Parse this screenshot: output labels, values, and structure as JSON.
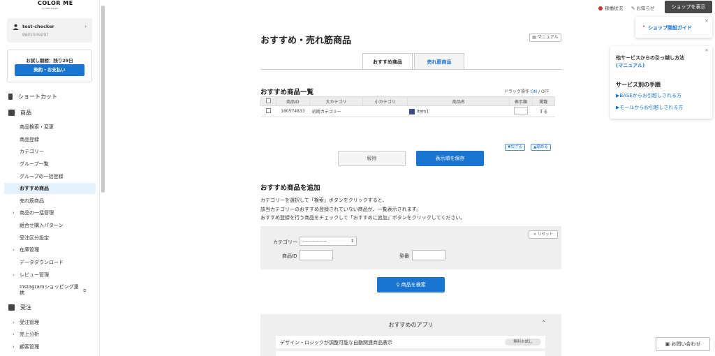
{
  "sidebar": {
    "logo": "COLOR ME",
    "logo_sub": "by GMO Pepabo",
    "account": {
      "name": "test-checker",
      "id": "PA01509297"
    },
    "trial": {
      "text": "お試し期間：残り29日",
      "button": "契約・お支払い"
    },
    "sections": {
      "shortcut": "ショートカット",
      "products": "商品",
      "orders": "受注"
    },
    "items": [
      {
        "label": "商品検索・変更"
      },
      {
        "label": "商品登録"
      },
      {
        "label": "カテゴリー"
      },
      {
        "label": "グループ一覧"
      },
      {
        "label": "グループの一括登録"
      },
      {
        "label": "おすすめ商品"
      },
      {
        "label": "売れ筋商品"
      },
      {
        "label": "商品の一括管理"
      },
      {
        "label": "組合せ購入パターン"
      },
      {
        "label": "受注区分設定"
      },
      {
        "label": "在庫管理"
      },
      {
        "label": "データダウンロード"
      },
      {
        "label": "レビュー管理"
      },
      {
        "label": "Instagramショッピング連携"
      }
    ],
    "order_items": [
      {
        "label": "受注管理"
      },
      {
        "label": "売上分析"
      },
      {
        "label": "顧客管理"
      }
    ]
  },
  "topbar": {
    "status": "稼働状況",
    "notice": "お知らせ",
    "shop_button": "ショップを表示"
  },
  "popups": {
    "guide": "ショップ開設ガイド",
    "move_line1": "他サービスからの引っ越し方法",
    "move_line2": "(マニュアル)",
    "move_heading": "サービス別の手順",
    "move_base": "▶BASEからお引越しされる方",
    "move_mall": "▶モールからお引越しされる方"
  },
  "main": {
    "title": "おすすめ・売れ筋商品",
    "manual": "マニュアル",
    "tabs": [
      "おすすめ商品",
      "売れ筋商品"
    ],
    "list_title": "おすすめ商品一覧",
    "drag_label": "ドラッグ操作",
    "drag_on": "ON",
    "drag_off": "/ OFF",
    "table": {
      "headers": [
        "商品ID",
        "大カテゴリ",
        "小カテゴリ",
        "商品名",
        "表示順",
        "掲載"
      ],
      "rows": [
        {
          "id": "180574833",
          "cat": "初期カテゴリー",
          "sub": "",
          "name": "item1",
          "order": "",
          "pub": "する"
        }
      ]
    },
    "expand": "▼広げる",
    "collapse": "▲縮める",
    "cancel": "解除",
    "save": "表示順を保存",
    "add_title": "おすすめ商品を追加",
    "desc1": "カテゴリーを選択して「検索」ボタンをクリックすると、",
    "desc2": "該当カテゴリーのおすすめ登録されていない商品が、一覧表示されます。",
    "desc3": "おすすめ登録を行う商品をチェックして「おすすめに追加」ボタンをクリックしてください。",
    "reset": "リセット",
    "category_label": "カテゴリー",
    "category_value": "---------------",
    "product_id_label": "商品ID",
    "model_label": "型番",
    "search": "商品を検索",
    "apps_title": "おすすめのアプリ",
    "app_row": "デザイン・ロジックが調整可能な自動関連商品表示",
    "app_badge": "無料お試し"
  },
  "contact": "お問い合わせ"
}
